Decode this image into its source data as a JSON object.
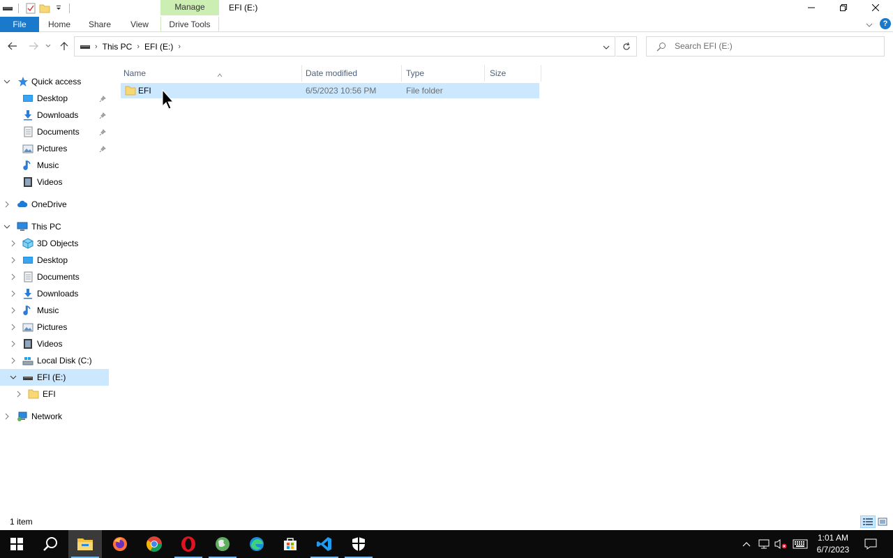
{
  "window": {
    "title": "EFI (E:)",
    "manage_tab": "Manage"
  },
  "ribbon": {
    "tabs": [
      {
        "label": "File"
      },
      {
        "label": "Home"
      },
      {
        "label": "Share"
      },
      {
        "label": "View"
      },
      {
        "label": "Drive Tools"
      }
    ]
  },
  "address": {
    "crumbs": [
      "This PC",
      "EFI (E:)"
    ],
    "search_placeholder": "Search EFI (E:)"
  },
  "nav": {
    "quick_access": "Quick access",
    "qa_items": [
      "Desktop",
      "Downloads",
      "Documents",
      "Pictures",
      "Music",
      "Videos"
    ],
    "onedrive": "OneDrive",
    "this_pc": "This PC",
    "pc_items": [
      "3D Objects",
      "Desktop",
      "Documents",
      "Downloads",
      "Music",
      "Pictures",
      "Videos",
      "Local Disk (C:)",
      "EFI (E:)"
    ],
    "efi_child": "EFI",
    "network": "Network"
  },
  "columns": {
    "name": "Name",
    "date": "Date modified",
    "type": "Type",
    "size": "Size"
  },
  "files": [
    {
      "name": "EFI",
      "date": "6/5/2023 10:56 PM",
      "type": "File folder",
      "size": ""
    }
  ],
  "status": {
    "count": "1 item"
  },
  "taskbar": {
    "time": "1:01 AM",
    "date": "6/7/2023"
  },
  "colors": {
    "accent": "#1979ca",
    "selection": "#cce8ff",
    "manage_tab": "#cdeeb3"
  }
}
